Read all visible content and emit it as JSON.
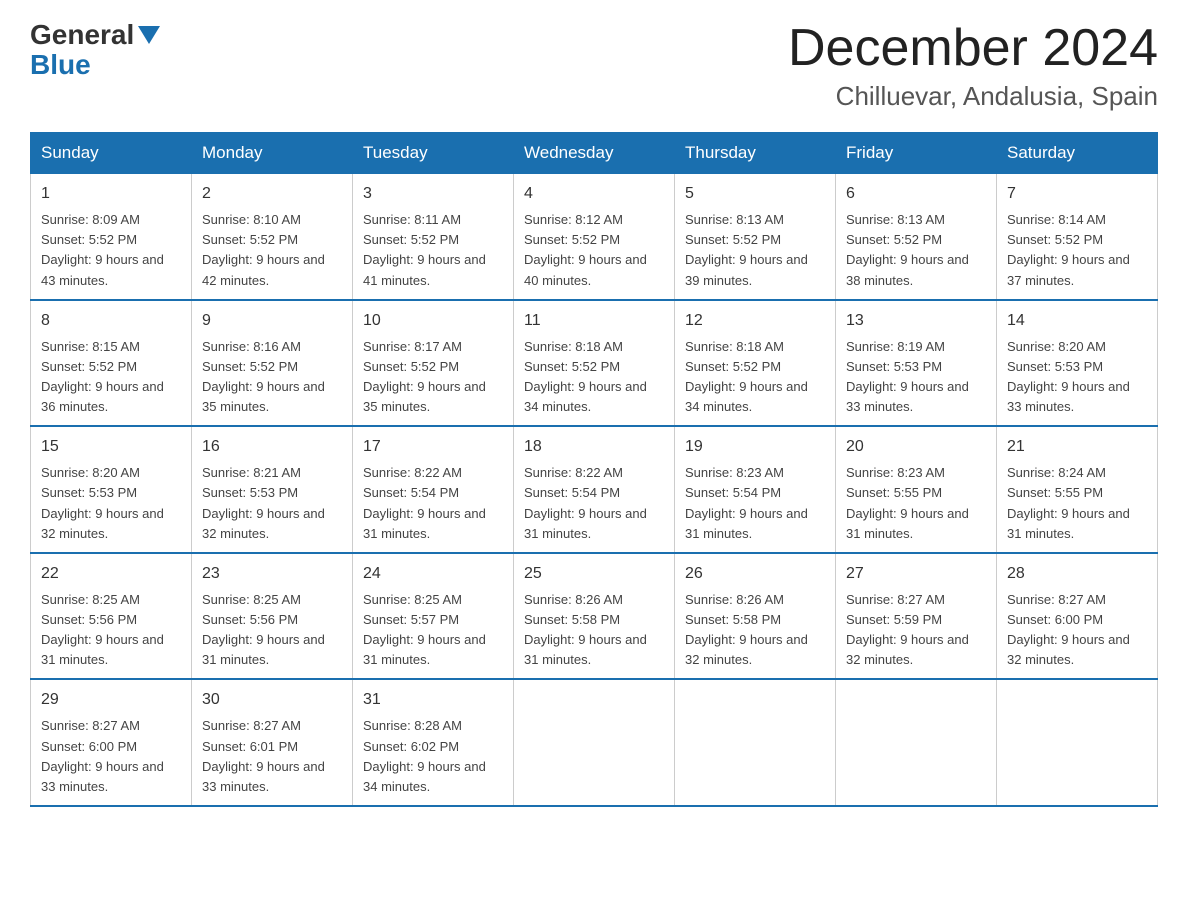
{
  "logo": {
    "line1": "General",
    "triangle_color": "#1a6faf",
    "line2": "Blue"
  },
  "header": {
    "month": "December 2024",
    "location": "Chilluevar, Andalusia, Spain"
  },
  "weekdays": [
    "Sunday",
    "Monday",
    "Tuesday",
    "Wednesday",
    "Thursday",
    "Friday",
    "Saturday"
  ],
  "weeks": [
    [
      {
        "day": "1",
        "sunrise": "8:09 AM",
        "sunset": "5:52 PM",
        "daylight": "9 hours and 43 minutes."
      },
      {
        "day": "2",
        "sunrise": "8:10 AM",
        "sunset": "5:52 PM",
        "daylight": "9 hours and 42 minutes."
      },
      {
        "day": "3",
        "sunrise": "8:11 AM",
        "sunset": "5:52 PM",
        "daylight": "9 hours and 41 minutes."
      },
      {
        "day": "4",
        "sunrise": "8:12 AM",
        "sunset": "5:52 PM",
        "daylight": "9 hours and 40 minutes."
      },
      {
        "day": "5",
        "sunrise": "8:13 AM",
        "sunset": "5:52 PM",
        "daylight": "9 hours and 39 minutes."
      },
      {
        "day": "6",
        "sunrise": "8:13 AM",
        "sunset": "5:52 PM",
        "daylight": "9 hours and 38 minutes."
      },
      {
        "day": "7",
        "sunrise": "8:14 AM",
        "sunset": "5:52 PM",
        "daylight": "9 hours and 37 minutes."
      }
    ],
    [
      {
        "day": "8",
        "sunrise": "8:15 AM",
        "sunset": "5:52 PM",
        "daylight": "9 hours and 36 minutes."
      },
      {
        "day": "9",
        "sunrise": "8:16 AM",
        "sunset": "5:52 PM",
        "daylight": "9 hours and 35 minutes."
      },
      {
        "day": "10",
        "sunrise": "8:17 AM",
        "sunset": "5:52 PM",
        "daylight": "9 hours and 35 minutes."
      },
      {
        "day": "11",
        "sunrise": "8:18 AM",
        "sunset": "5:52 PM",
        "daylight": "9 hours and 34 minutes."
      },
      {
        "day": "12",
        "sunrise": "8:18 AM",
        "sunset": "5:52 PM",
        "daylight": "9 hours and 34 minutes."
      },
      {
        "day": "13",
        "sunrise": "8:19 AM",
        "sunset": "5:53 PM",
        "daylight": "9 hours and 33 minutes."
      },
      {
        "day": "14",
        "sunrise": "8:20 AM",
        "sunset": "5:53 PM",
        "daylight": "9 hours and 33 minutes."
      }
    ],
    [
      {
        "day": "15",
        "sunrise": "8:20 AM",
        "sunset": "5:53 PM",
        "daylight": "9 hours and 32 minutes."
      },
      {
        "day": "16",
        "sunrise": "8:21 AM",
        "sunset": "5:53 PM",
        "daylight": "9 hours and 32 minutes."
      },
      {
        "day": "17",
        "sunrise": "8:22 AM",
        "sunset": "5:54 PM",
        "daylight": "9 hours and 31 minutes."
      },
      {
        "day": "18",
        "sunrise": "8:22 AM",
        "sunset": "5:54 PM",
        "daylight": "9 hours and 31 minutes."
      },
      {
        "day": "19",
        "sunrise": "8:23 AM",
        "sunset": "5:54 PM",
        "daylight": "9 hours and 31 minutes."
      },
      {
        "day": "20",
        "sunrise": "8:23 AM",
        "sunset": "5:55 PM",
        "daylight": "9 hours and 31 minutes."
      },
      {
        "day": "21",
        "sunrise": "8:24 AM",
        "sunset": "5:55 PM",
        "daylight": "9 hours and 31 minutes."
      }
    ],
    [
      {
        "day": "22",
        "sunrise": "8:25 AM",
        "sunset": "5:56 PM",
        "daylight": "9 hours and 31 minutes."
      },
      {
        "day": "23",
        "sunrise": "8:25 AM",
        "sunset": "5:56 PM",
        "daylight": "9 hours and 31 minutes."
      },
      {
        "day": "24",
        "sunrise": "8:25 AM",
        "sunset": "5:57 PM",
        "daylight": "9 hours and 31 minutes."
      },
      {
        "day": "25",
        "sunrise": "8:26 AM",
        "sunset": "5:58 PM",
        "daylight": "9 hours and 31 minutes."
      },
      {
        "day": "26",
        "sunrise": "8:26 AM",
        "sunset": "5:58 PM",
        "daylight": "9 hours and 32 minutes."
      },
      {
        "day": "27",
        "sunrise": "8:27 AM",
        "sunset": "5:59 PM",
        "daylight": "9 hours and 32 minutes."
      },
      {
        "day": "28",
        "sunrise": "8:27 AM",
        "sunset": "6:00 PM",
        "daylight": "9 hours and 32 minutes."
      }
    ],
    [
      {
        "day": "29",
        "sunrise": "8:27 AM",
        "sunset": "6:00 PM",
        "daylight": "9 hours and 33 minutes."
      },
      {
        "day": "30",
        "sunrise": "8:27 AM",
        "sunset": "6:01 PM",
        "daylight": "9 hours and 33 minutes."
      },
      {
        "day": "31",
        "sunrise": "8:28 AM",
        "sunset": "6:02 PM",
        "daylight": "9 hours and 34 minutes."
      },
      null,
      null,
      null,
      null
    ]
  ]
}
